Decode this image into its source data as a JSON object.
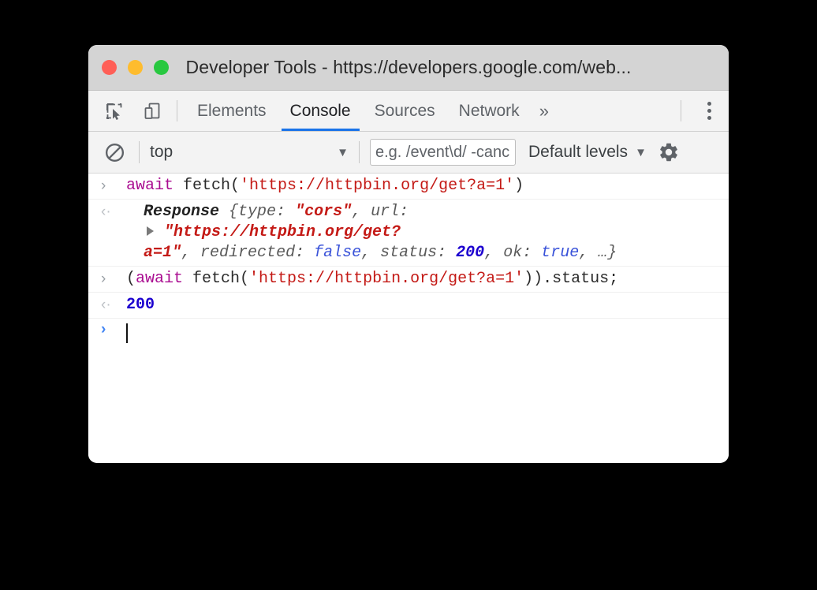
{
  "window": {
    "title": "Developer Tools - https://developers.google.com/web...",
    "traffic_lights": [
      {
        "name": "close",
        "color": "#ff5f57"
      },
      {
        "name": "minimize",
        "color": "#febc2e"
      },
      {
        "name": "zoom",
        "color": "#28c840"
      }
    ]
  },
  "tabbar": {
    "inspect_icon": "inspect-element-icon",
    "device_icon": "device-toolbar-icon",
    "tabs": [
      {
        "label": "Elements",
        "active": false
      },
      {
        "label": "Console",
        "active": true
      },
      {
        "label": "Sources",
        "active": false
      },
      {
        "label": "Network",
        "active": false
      }
    ],
    "more_label": "»",
    "menu_icon": "kebab-menu-icon",
    "active_underline_color": "#1a73e8"
  },
  "console_toolbar": {
    "clear_icon": "clear-console-icon",
    "context": {
      "value": "top",
      "caret": "▼"
    },
    "filter": {
      "placeholder": "e.g. /event\\d/ -cancelled",
      "value": ""
    },
    "levels": {
      "label": "Default levels",
      "caret": "▼"
    },
    "settings_icon": "gear-icon"
  },
  "console": {
    "gutter_input": "›",
    "gutter_output": "‹·",
    "entries": [
      {
        "kind": "input",
        "text": "await fetch('https://httpbin.org/get?a=1')"
      },
      {
        "kind": "output-object",
        "class_name": "Response",
        "open_brace": "{",
        "prop_type": "type:",
        "val_type": "\"cors\"",
        "comma1": ",",
        "prop_url": "url:",
        "url_part1": "\"https://httpbin.org/get?",
        "url_part2": "a=1\"",
        "comma2": ",",
        "prop_redirected": "redirected:",
        "val_redirected": "false",
        "comma3": ",",
        "prop_status": "status:",
        "val_status": "200",
        "comma4": ",",
        "prop_ok": "ok:",
        "val_ok": "true",
        "tail": ", …}"
      },
      {
        "kind": "input",
        "text": "(await fetch('https://httpbin.org/get?a=1')).status;"
      },
      {
        "kind": "output-number",
        "text": "200"
      }
    ],
    "prompt": {
      "marker": "›",
      "value": ""
    }
  }
}
